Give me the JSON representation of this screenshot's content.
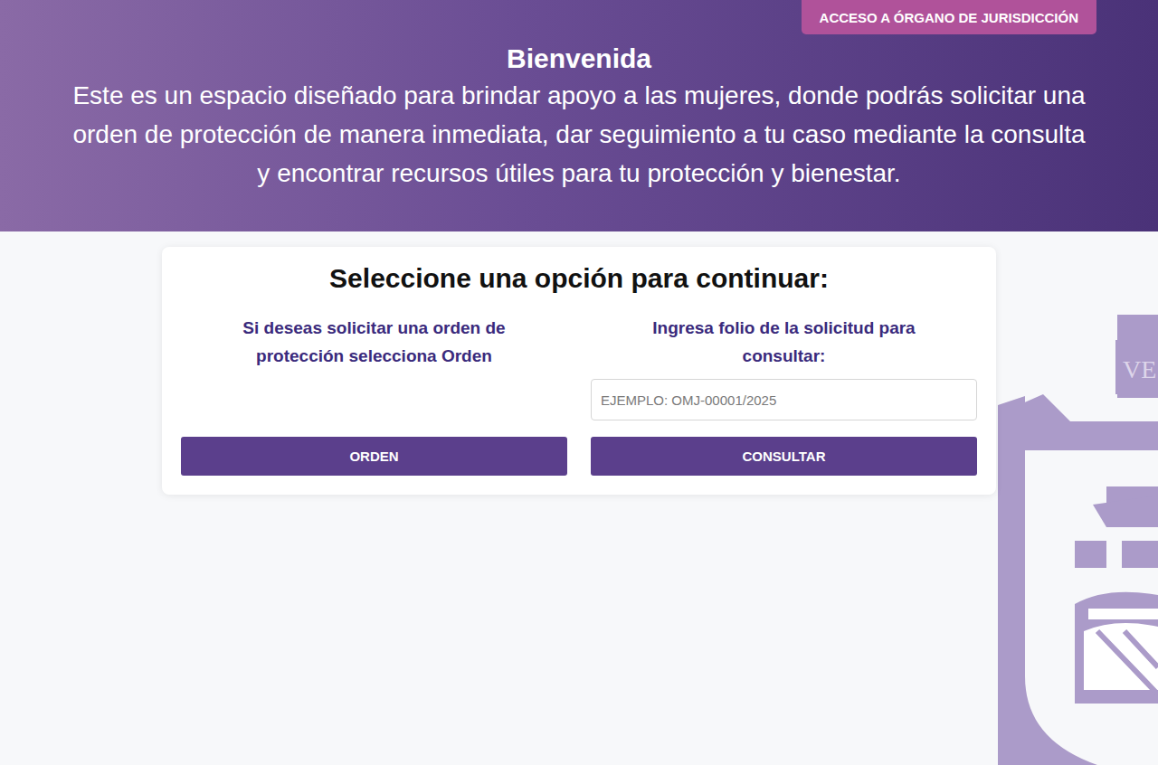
{
  "header": {
    "jurisdiction_button": "ACCESO A ÓRGANO DE JURISDICCIÓN",
    "title": "Bienvenida",
    "description": "Este es un espacio diseñado para brindar apoyo a las mujeres, donde podrás solicitar una orden de protección de manera inmediata, dar seguimiento a tu caso mediante la consulta y encontrar recursos útiles para tu protección y bienestar."
  },
  "card": {
    "title": "Seleccione una opción para continuar:",
    "options": [
      {
        "prompt": "Si deseas solicitar una orden de protección selecciona Orden",
        "input_placeholder": null,
        "button": "ORDEN"
      },
      {
        "prompt": "Ingresa folio de la solicitud para consultar:",
        "input_placeholder": "EJEMPLO: OMJ-00001/2025",
        "button": "CONSULTAR"
      }
    ]
  },
  "emblem": {
    "text": "VE"
  }
}
